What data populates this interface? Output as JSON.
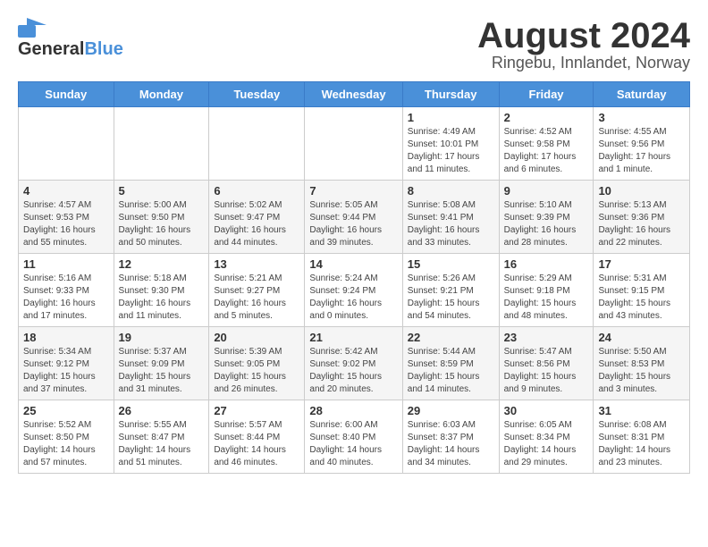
{
  "logo": {
    "text_general": "General",
    "text_blue": "Blue"
  },
  "title": {
    "month_year": "August 2024",
    "location": "Ringebu, Innlandet, Norway"
  },
  "days_of_week": [
    "Sunday",
    "Monday",
    "Tuesday",
    "Wednesday",
    "Thursday",
    "Friday",
    "Saturday"
  ],
  "weeks": [
    [
      {
        "day": "",
        "info": ""
      },
      {
        "day": "",
        "info": ""
      },
      {
        "day": "",
        "info": ""
      },
      {
        "day": "",
        "info": ""
      },
      {
        "day": "1",
        "info": "Sunrise: 4:49 AM\nSunset: 10:01 PM\nDaylight: 17 hours\nand 11 minutes."
      },
      {
        "day": "2",
        "info": "Sunrise: 4:52 AM\nSunset: 9:58 PM\nDaylight: 17 hours\nand 6 minutes."
      },
      {
        "day": "3",
        "info": "Sunrise: 4:55 AM\nSunset: 9:56 PM\nDaylight: 17 hours\nand 1 minute."
      }
    ],
    [
      {
        "day": "4",
        "info": "Sunrise: 4:57 AM\nSunset: 9:53 PM\nDaylight: 16 hours\nand 55 minutes."
      },
      {
        "day": "5",
        "info": "Sunrise: 5:00 AM\nSunset: 9:50 PM\nDaylight: 16 hours\nand 50 minutes."
      },
      {
        "day": "6",
        "info": "Sunrise: 5:02 AM\nSunset: 9:47 PM\nDaylight: 16 hours\nand 44 minutes."
      },
      {
        "day": "7",
        "info": "Sunrise: 5:05 AM\nSunset: 9:44 PM\nDaylight: 16 hours\nand 39 minutes."
      },
      {
        "day": "8",
        "info": "Sunrise: 5:08 AM\nSunset: 9:41 PM\nDaylight: 16 hours\nand 33 minutes."
      },
      {
        "day": "9",
        "info": "Sunrise: 5:10 AM\nSunset: 9:39 PM\nDaylight: 16 hours\nand 28 minutes."
      },
      {
        "day": "10",
        "info": "Sunrise: 5:13 AM\nSunset: 9:36 PM\nDaylight: 16 hours\nand 22 minutes."
      }
    ],
    [
      {
        "day": "11",
        "info": "Sunrise: 5:16 AM\nSunset: 9:33 PM\nDaylight: 16 hours\nand 17 minutes."
      },
      {
        "day": "12",
        "info": "Sunrise: 5:18 AM\nSunset: 9:30 PM\nDaylight: 16 hours\nand 11 minutes."
      },
      {
        "day": "13",
        "info": "Sunrise: 5:21 AM\nSunset: 9:27 PM\nDaylight: 16 hours\nand 5 minutes."
      },
      {
        "day": "14",
        "info": "Sunrise: 5:24 AM\nSunset: 9:24 PM\nDaylight: 16 hours\nand 0 minutes."
      },
      {
        "day": "15",
        "info": "Sunrise: 5:26 AM\nSunset: 9:21 PM\nDaylight: 15 hours\nand 54 minutes."
      },
      {
        "day": "16",
        "info": "Sunrise: 5:29 AM\nSunset: 9:18 PM\nDaylight: 15 hours\nand 48 minutes."
      },
      {
        "day": "17",
        "info": "Sunrise: 5:31 AM\nSunset: 9:15 PM\nDaylight: 15 hours\nand 43 minutes."
      }
    ],
    [
      {
        "day": "18",
        "info": "Sunrise: 5:34 AM\nSunset: 9:12 PM\nDaylight: 15 hours\nand 37 minutes."
      },
      {
        "day": "19",
        "info": "Sunrise: 5:37 AM\nSunset: 9:09 PM\nDaylight: 15 hours\nand 31 minutes."
      },
      {
        "day": "20",
        "info": "Sunrise: 5:39 AM\nSunset: 9:05 PM\nDaylight: 15 hours\nand 26 minutes."
      },
      {
        "day": "21",
        "info": "Sunrise: 5:42 AM\nSunset: 9:02 PM\nDaylight: 15 hours\nand 20 minutes."
      },
      {
        "day": "22",
        "info": "Sunrise: 5:44 AM\nSunset: 8:59 PM\nDaylight: 15 hours\nand 14 minutes."
      },
      {
        "day": "23",
        "info": "Sunrise: 5:47 AM\nSunset: 8:56 PM\nDaylight: 15 hours\nand 9 minutes."
      },
      {
        "day": "24",
        "info": "Sunrise: 5:50 AM\nSunset: 8:53 PM\nDaylight: 15 hours\nand 3 minutes."
      }
    ],
    [
      {
        "day": "25",
        "info": "Sunrise: 5:52 AM\nSunset: 8:50 PM\nDaylight: 14 hours\nand 57 minutes."
      },
      {
        "day": "26",
        "info": "Sunrise: 5:55 AM\nSunset: 8:47 PM\nDaylight: 14 hours\nand 51 minutes."
      },
      {
        "day": "27",
        "info": "Sunrise: 5:57 AM\nSunset: 8:44 PM\nDaylight: 14 hours\nand 46 minutes."
      },
      {
        "day": "28",
        "info": "Sunrise: 6:00 AM\nSunset: 8:40 PM\nDaylight: 14 hours\nand 40 minutes."
      },
      {
        "day": "29",
        "info": "Sunrise: 6:03 AM\nSunset: 8:37 PM\nDaylight: 14 hours\nand 34 minutes."
      },
      {
        "day": "30",
        "info": "Sunrise: 6:05 AM\nSunset: 8:34 PM\nDaylight: 14 hours\nand 29 minutes."
      },
      {
        "day": "31",
        "info": "Sunrise: 6:08 AM\nSunset: 8:31 PM\nDaylight: 14 hours\nand 23 minutes."
      }
    ]
  ]
}
